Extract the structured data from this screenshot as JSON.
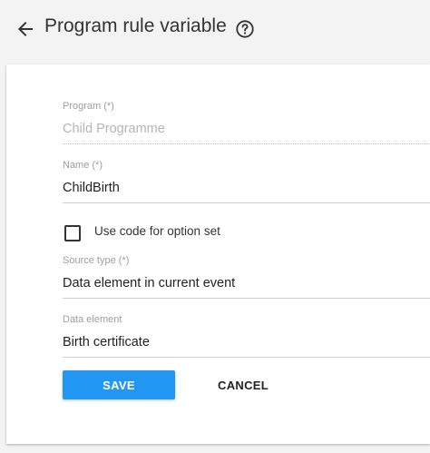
{
  "header": {
    "title": "Program rule variable",
    "back_icon": "arrow-left-icon",
    "help_icon": "help-circle-icon"
  },
  "form": {
    "program": {
      "label": "Program (*)",
      "value": "Child Programme"
    },
    "name": {
      "label": "Name (*)",
      "value": "ChildBirth"
    },
    "use_code_checkbox": {
      "label": "Use code for option set",
      "checked": false
    },
    "source_type": {
      "label": "Source type (*)",
      "value": "Data element in current event"
    },
    "data_element": {
      "label": "Data element",
      "value": "Birth certificate"
    }
  },
  "actions": {
    "save_label": "SAVE",
    "cancel_label": "CANCEL"
  },
  "colors": {
    "primary": "#2196f3",
    "background": "#f3f3f3",
    "card": "#ffffff"
  }
}
